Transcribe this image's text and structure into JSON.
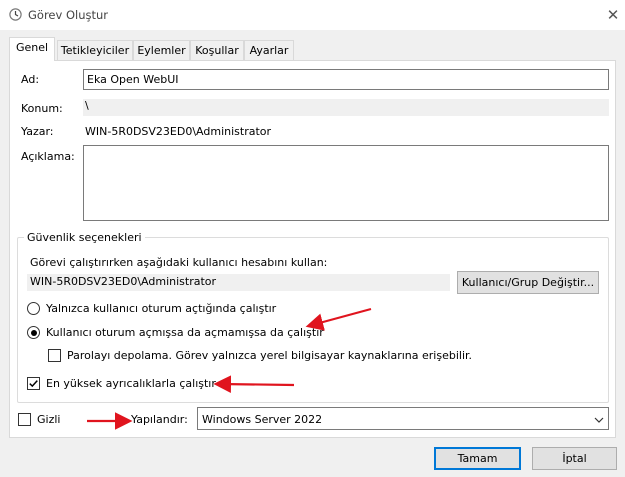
{
  "window": {
    "title": "Görev Oluştur",
    "close_glyph": "✕"
  },
  "tabs": [
    {
      "label": "Genel"
    },
    {
      "label": "Tetikleyiciler"
    },
    {
      "label": "Eylemler"
    },
    {
      "label": "Koşullar"
    },
    {
      "label": "Ayarlar"
    }
  ],
  "general": {
    "name_label": "Ad:",
    "name_value": "Eka Open WebUI",
    "location_label": "Konum:",
    "location_value": "\\",
    "author_label": "Yazar:",
    "author_value": "WIN-5R0DSV23ED0\\Administrator",
    "description_label": "Açıklama:",
    "description_value": ""
  },
  "security": {
    "group_title": "Güvenlik seçenekleri",
    "run_as_prompt": "Görevi çalıştırırken aşağıdaki kullanıcı hesabını kullan:",
    "user_account": "WIN-5R0DSV23ED0\\Administrator",
    "change_user_button": "Kullanıcı/Grup Değiştir...",
    "radio_logged_on": "Yalnızca kullanıcı oturum açtığında çalıştır",
    "radio_whether_logged": "Kullanıcı oturum açmışsa da açmamışsa da çalıştır",
    "checkbox_no_password": "Parolayı depolama. Görev yalnızca yerel bilgisayar kaynaklarına erişebilir.",
    "checkbox_highest": "En yüksek ayrıcalıklarla çalıştır",
    "selected_radio": "radio_whether_logged",
    "highest_checked": true,
    "no_password_checked": false
  },
  "footer": {
    "hidden_label": "Gizli",
    "hidden_checked": false,
    "configure_label": "Yapılandır:",
    "configure_value": "Windows Server 2022",
    "ok_button": "Tamam",
    "cancel_button": "İptal"
  },
  "colors": {
    "accent": "#0078d7",
    "annotation_arrow": "#e0141e"
  }
}
